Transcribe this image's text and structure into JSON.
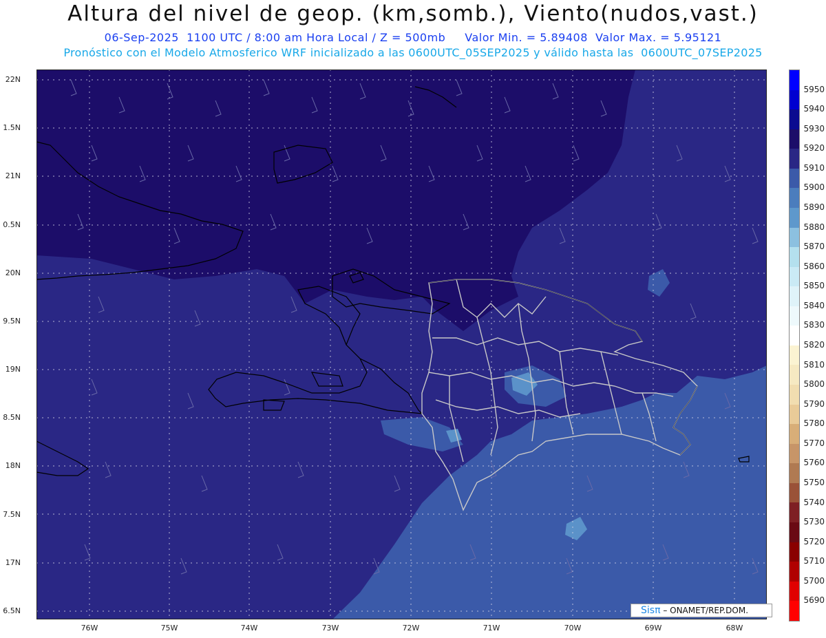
{
  "header": {
    "title": "Altura del nivel de geop. (km,somb.), Viento(nudos,vast.)",
    "subtitle_1": "06-Sep-2025  1100 UTC / 8:00 am Hora Local / Z = 500mb     Valor Min. = 5.89408  Valor Max. = 5.95121",
    "subtitle_2": "Pronóstico con el Modelo Atmosferico WRF inicializado a las 0600UTC_05SEP2025 y válido hasta las  0600UTC_07SEP2025"
  },
  "map": {
    "latitude_labels": [
      "22N",
      "1.5N",
      "21N",
      "0.5N",
      "20N",
      "9.5N",
      "19N",
      "8.5N",
      "18N",
      "7.5N",
      "17N",
      "6.5N"
    ],
    "longitude_labels": [
      "76W",
      "75W",
      "74W",
      "73W",
      "72W",
      "71W",
      "70W",
      "69W",
      "68W"
    ],
    "colors": {
      "deep": "#1c0d69",
      "main": "#2a2785",
      "mid": "#3b5aa9",
      "light": "#5b92c9",
      "coast": "#000000",
      "borders": "#c8c8c8",
      "barbs": "#6a6aa8"
    }
  },
  "legend": {
    "levels": [
      "5950",
      "5940",
      "5930",
      "5920",
      "5910",
      "5900",
      "5890",
      "5880",
      "5870",
      "5860",
      "5850",
      "5840",
      "5830",
      "5820",
      "5810",
      "5800",
      "5790",
      "5780",
      "5770",
      "5760",
      "5750",
      "5740",
      "5730",
      "5720",
      "5710",
      "5700",
      "5690"
    ],
    "colors": [
      "#0000ff",
      "#0000d0",
      "#0b0b90",
      "#1c0d69",
      "#2a2785",
      "#3b5aa9",
      "#4b7dbd",
      "#5e98cc",
      "#8cc0e0",
      "#b4e0ee",
      "#caeaf5",
      "#dff3f9",
      "#eef9fc",
      "#ffffff",
      "#fbf3d2",
      "#f6e9c2",
      "#f1ddb0",
      "#e9cb98",
      "#d8ae78",
      "#c79568",
      "#b07a52",
      "#9a5238",
      "#7e1f24",
      "#6a0a14",
      "#8a0000",
      "#b00000",
      "#e00000",
      "#ff0000"
    ]
  },
  "credit": {
    "brand": "Sisπ",
    "text": " – ONAMET/REP.DOM."
  }
}
